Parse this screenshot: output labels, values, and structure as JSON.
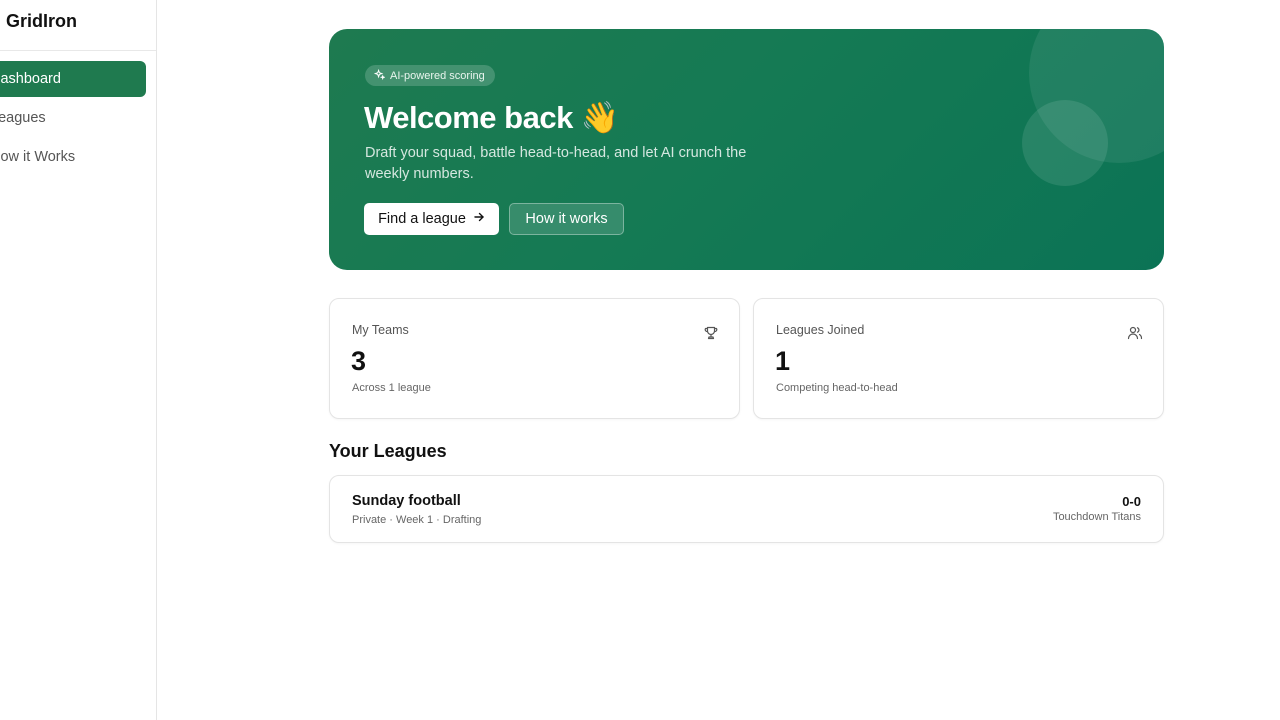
{
  "app": {
    "brand": "GridIron"
  },
  "sidebar": {
    "items": [
      {
        "label": "Dashboard",
        "active": true
      },
      {
        "label": "Leagues",
        "active": false
      },
      {
        "label": "How it Works",
        "active": false
      }
    ]
  },
  "hero": {
    "badge": "AI-powered scoring",
    "badge_icon": "sparkles-icon",
    "title": "Welcome back 👋",
    "subtitle": "Draft your squad, battle head-to-head, and let AI crunch the weekly numbers.",
    "primary_button": "Find a league",
    "primary_button_icon": "arrow-right-icon",
    "secondary_button": "How it works"
  },
  "stats": [
    {
      "label": "My Teams",
      "value": "3",
      "note": "Across 1 league",
      "icon": "trophy-icon"
    },
    {
      "label": "Leagues Joined",
      "value": "1",
      "note": "Competing head-to-head",
      "icon": "users-icon"
    }
  ],
  "leagues_section": {
    "title": "Your Leagues",
    "leagues": [
      {
        "name": "Sunday football",
        "meta": "Private · Week 1 · Drafting",
        "record": "0-0",
        "team": "Touchdown Titans"
      }
    ]
  },
  "colors": {
    "accent": "#1f7a4f",
    "hero_start": "#1e7a50",
    "hero_end": "#0b7355"
  }
}
